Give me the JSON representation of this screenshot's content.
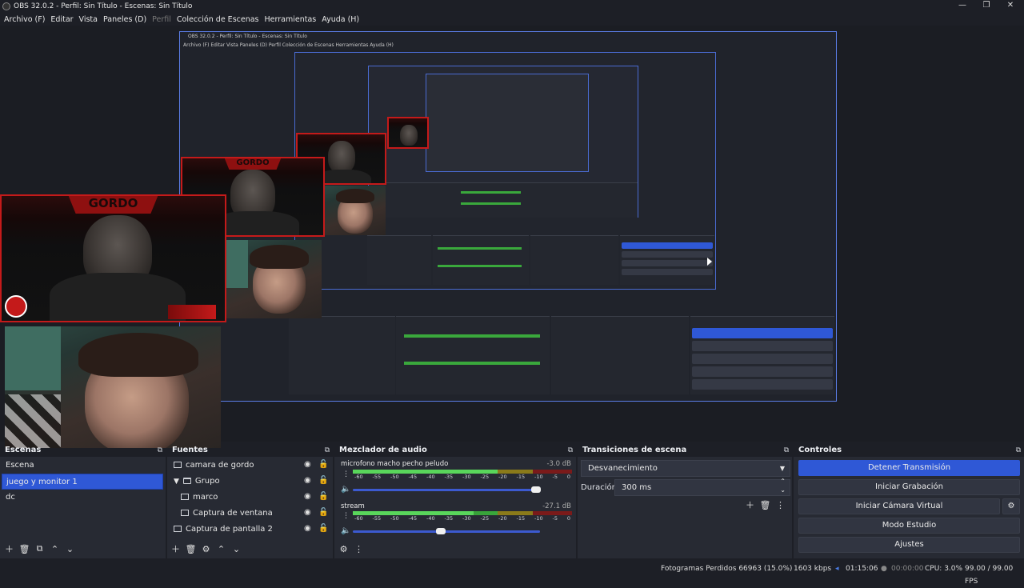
{
  "window": {
    "title": "OBS 32.0.2 - Perfil: Sin Título - Escenas: Sin Título",
    "minimize": "—",
    "maximize": "❐",
    "close": "✕"
  },
  "menu": [
    "Archivo (F)",
    "Editar",
    "Vista",
    "Paneles (D)",
    "Perfil",
    "Colección de Escenas",
    "Herramientas",
    "Ayuda (H)"
  ],
  "preview": {
    "inner_title": "OBS 32.0.2 - Perfil: Sin Título - Escenas: Sin Título",
    "inner_menu": "Archivo (F)   Editar   Vista   Paneles (D)   Perfil   Colección de Escenas   Herramientas   Ayuda (H)",
    "overlay_brand": "GORDO"
  },
  "docks": {
    "scenes": {
      "title": "Escenas",
      "items": [
        "Escena",
        "juego y monitor 1",
        "dc"
      ],
      "selected_index": 1
    },
    "sources": {
      "title": "Fuentes",
      "items": [
        {
          "label": "camara de gordo",
          "icon": "monitor-icon",
          "indent": 0
        },
        {
          "label": "Grupo",
          "icon": "folder-icon",
          "indent": 1
        },
        {
          "label": "marco",
          "icon": "image-icon",
          "indent": 2
        },
        {
          "label": "Captura de ventana",
          "icon": "window-icon",
          "indent": 2
        },
        {
          "label": "Captura de pantalla 2",
          "icon": "monitor-icon",
          "indent": 0
        }
      ]
    },
    "mixer": {
      "title": "Mezclador de audio",
      "ticks": [
        "-60",
        "-55",
        "-50",
        "-45",
        "-40",
        "-35",
        "-30",
        "-25",
        "-20",
        "-15",
        "-10",
        "-5",
        "0"
      ],
      "channels": [
        {
          "name": "microfono macho pecho peludo",
          "db": "-3.0 dB",
          "level": 0.66,
          "volume": 0.98
        },
        {
          "name": "stream",
          "db": "-27.1 dB",
          "level": 0.55,
          "volume": 0.47
        }
      ]
    },
    "transitions": {
      "title": "Transiciones de escena",
      "selected": "Desvanecimiento",
      "duration_label": "Duración",
      "duration_value": "300 ms"
    },
    "controls": {
      "title": "Controles",
      "buttons": [
        "Detener Transmisión",
        "Iniciar Grabación",
        "Iniciar Cámara Virtual",
        "Modo Estudio",
        "Ajustes"
      ]
    }
  },
  "status": {
    "dropped": "Fotogramas Perdidos 66963 (15.0%)",
    "bitrate": "1603 kbps",
    "stream_time": "01:15:06",
    "rec_time": "00:00:00",
    "cpu": "CPU: 3.0%",
    "fps": "99.00 / 99.00 FPS"
  },
  "colors": {
    "accent": "#2f58d6",
    "capture_red": "#c41a1a",
    "panel": "#272a33",
    "background": "#1d1f26"
  }
}
